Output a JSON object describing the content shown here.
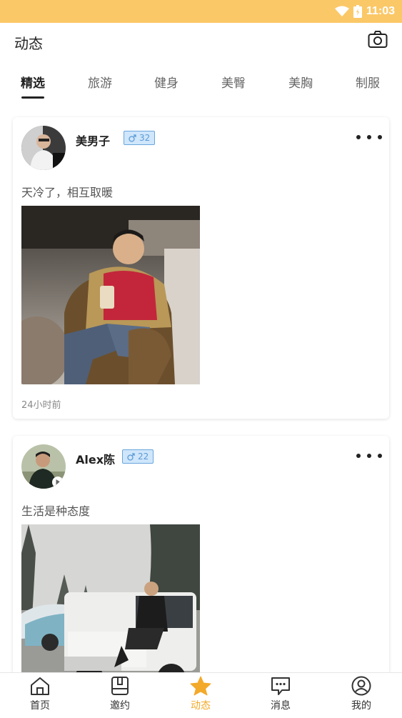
{
  "status_bar": {
    "time": "11:03",
    "background": "#fbc868"
  },
  "header": {
    "title": "动态",
    "camera_icon": "camera-icon"
  },
  "tabs": [
    {
      "label": "精选",
      "active": true
    },
    {
      "label": "旅游",
      "active": false
    },
    {
      "label": "健身",
      "active": false
    },
    {
      "label": "美臀",
      "active": false
    },
    {
      "label": "美胸",
      "active": false
    },
    {
      "label": "制服",
      "active": false
    }
  ],
  "posts": [
    {
      "username": "美男子",
      "gender_icon": "male-icon",
      "age": "32",
      "text": "天冷了，相互取暖",
      "time": "24小时前"
    },
    {
      "username": "Alex陈",
      "gender_icon": "male-icon",
      "age": "22",
      "text": "生活是种态度"
    }
  ],
  "bottom_nav": [
    {
      "label": "首页",
      "icon": "home-icon",
      "active": false
    },
    {
      "label": "邀约",
      "icon": "invite-icon",
      "active": false
    },
    {
      "label": "动态",
      "icon": "star-icon",
      "active": true
    },
    {
      "label": "消息",
      "icon": "message-icon",
      "active": false
    },
    {
      "label": "我的",
      "icon": "profile-icon",
      "active": false
    }
  ],
  "colors": {
    "accent": "#f3a929",
    "badge_border": "#6aa6dc",
    "badge_fill": "#cfe6fb"
  }
}
